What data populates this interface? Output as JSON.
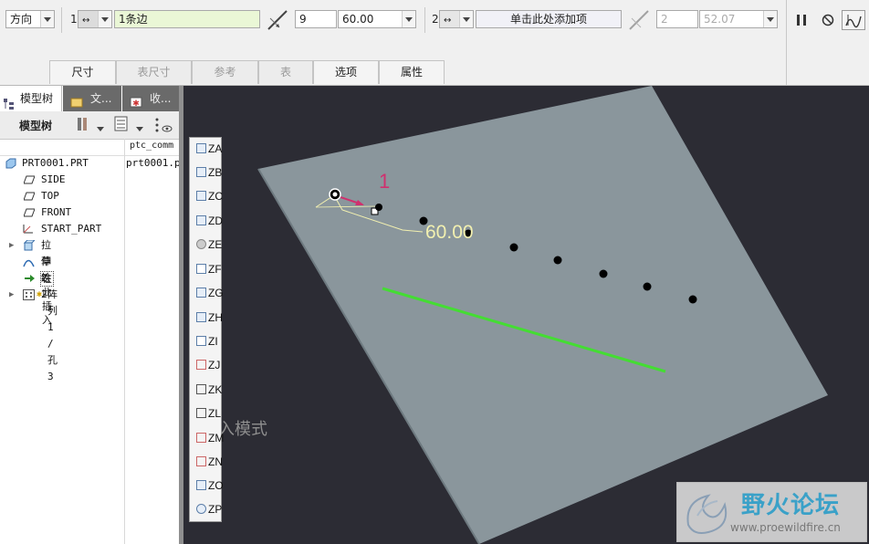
{
  "dashboard": {
    "direction_label": "方向",
    "set1_number": "1",
    "set1_reference": "1条边",
    "set1_count": "9",
    "set1_increment": "60.00",
    "set2_number": "2",
    "set2_reference_placeholder": "单击此处添加项",
    "set2_count": "2",
    "set2_increment": "52.07"
  },
  "tabs": [
    {
      "label": "尺寸",
      "active": true
    },
    {
      "label": "表尺寸",
      "active": false
    },
    {
      "label": "参考",
      "active": false
    },
    {
      "label": "表",
      "active": false
    },
    {
      "label": "选项",
      "active": true
    },
    {
      "label": "属性",
      "active": true
    }
  ],
  "panel": {
    "tabs": [
      "模型树",
      "文...",
      "收..."
    ],
    "toolbar_label": "模型树",
    "column_header": "ptc_comm",
    "rows": [
      {
        "label": "PRT0001.PRT",
        "value": "prt0001.p",
        "icon": "part-icon"
      },
      {
        "label": "SIDE",
        "icon": "datum-plane-icon"
      },
      {
        "label": "TOP",
        "icon": "datum-plane-icon"
      },
      {
        "label": "FRONT",
        "icon": "datum-plane-icon"
      },
      {
        "label": "START_PART",
        "icon": "coordinate-system-icon"
      },
      {
        "label": "拉伸 2",
        "icon": "extrude-icon"
      },
      {
        "label": "草绘 2",
        "icon": "sketch-icon"
      },
      {
        "label": "在此插入",
        "icon": "insert-arrow-icon"
      },
      {
        "label": "阵列 1 / 孔 3",
        "icon": "pattern-icon"
      }
    ]
  },
  "vertical_toolbar": [
    "ZA",
    "ZB",
    "ZC",
    "ZD",
    "ZE",
    "ZF",
    "ZG",
    "ZH",
    "ZI",
    "ZJ",
    "ZK",
    "ZL",
    "ZM",
    "ZN",
    "ZO",
    "ZP"
  ],
  "canvas": {
    "dimension_index": "1",
    "dimension_value": "60.00",
    "mode_text": "入模式",
    "watermark_title": "野火论坛",
    "watermark_url": "www.proewildfire.cn"
  },
  "colors": {
    "canvas_bg": "#2c2c34",
    "plate": "#8a969c",
    "green_edge": "#44dd33",
    "dimension": "#f2f0b0",
    "index_label": "#d0306e",
    "active_field": "#eaf7d6"
  }
}
